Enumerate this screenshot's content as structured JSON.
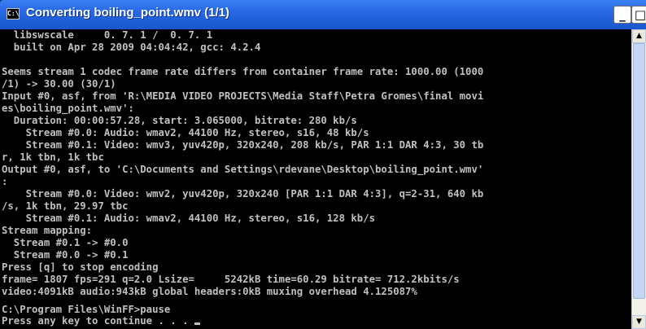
{
  "window": {
    "title": "Converting boiling_point.wmv (1/1)",
    "app_icon": "C:\\",
    "buttons": {
      "minimize": "_",
      "maximize": "□"
    }
  },
  "console": {
    "lines": [
      "  libswscale     0. 7. 1 /  0. 7. 1",
      "  built on Apr 28 2009 04:04:42, gcc: 4.2.4",
      "",
      "Seems stream 1 codec frame rate differs from container frame rate: 1000.00 (1000",
      "/1) -> 30.00 (30/1)",
      "Input #0, asf, from 'R:\\MEDIA VIDEO PROJECTS\\Media Staff\\Petra Gromes\\final movi",
      "es\\boiling_point.wmv':",
      "  Duration: 00:00:57.28, start: 3.065000, bitrate: 280 kb/s",
      "    Stream #0.0: Audio: wmav2, 44100 Hz, stereo, s16, 48 kb/s",
      "    Stream #0.1: Video: wmv3, yuv420p, 320x240, 208 kb/s, PAR 1:1 DAR 4:3, 30 tb",
      "r, 1k tbn, 1k tbc",
      "Output #0, asf, to 'C:\\Documents and Settings\\rdevane\\Desktop\\boiling_point.wmv'",
      ":",
      "    Stream #0.0: Video: wmv2, yuv420p, 320x240 [PAR 1:1 DAR 4:3], q=2-31, 640 kb",
      "/s, 1k tbn, 29.97 tbc",
      "    Stream #0.1: Audio: wmav2, 44100 Hz, stereo, s16, 128 kb/s",
      "Stream mapping:",
      "  Stream #0.1 -> #0.0",
      "  Stream #0.0 -> #0.1",
      "Press [q] to stop encoding",
      "frame= 1807 fps=291 q=2.0 Lsize=     5242kB time=60.29 bitrate= 712.2kbits/s",
      "video:4091kB audio:943kB global headers:0kB muxing overhead 4.125087%",
      "",
      "C:\\Program Files\\WinFF>pause",
      "Press any key to continue . . . "
    ]
  },
  "scrollbar": {
    "up_arrow": "▲",
    "down_arrow": "▼"
  },
  "colors": {
    "titlebar": "#2a6ae6",
    "console_bg": "#000000",
    "console_text": "#c0c0c0"
  }
}
